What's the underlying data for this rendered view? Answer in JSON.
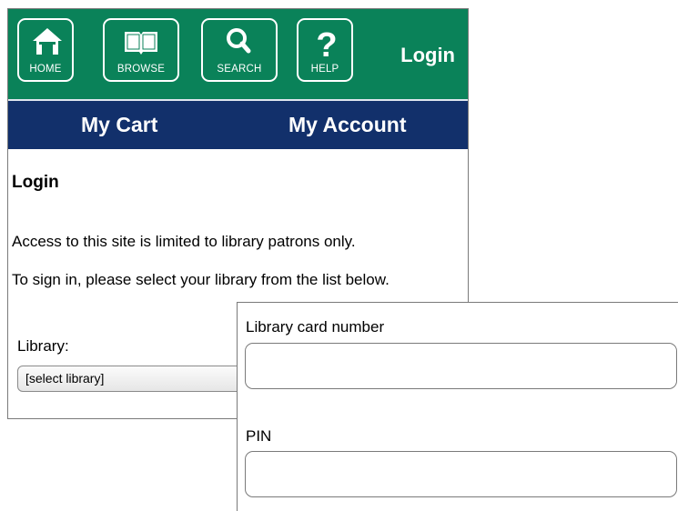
{
  "nav": {
    "home_label": "HOME",
    "browse_label": "BROWSE",
    "search_label": "SEARCH",
    "help_label": "HELP",
    "login_label": "Login"
  },
  "subnav": {
    "cart_label": "My Cart",
    "account_label": "My Account"
  },
  "page": {
    "heading": "Login",
    "notice": "Access to this site is limited to library patrons only.",
    "instructions": "To sign in, please select your library from the list below.",
    "library_label": "Library:",
    "library_selected": "[select library]"
  },
  "form": {
    "card_label": "Library card number",
    "card_value": "",
    "pin_label": "PIN",
    "pin_value": ""
  },
  "colors": {
    "topbar": "#0a8259",
    "subbar": "#12306b"
  }
}
